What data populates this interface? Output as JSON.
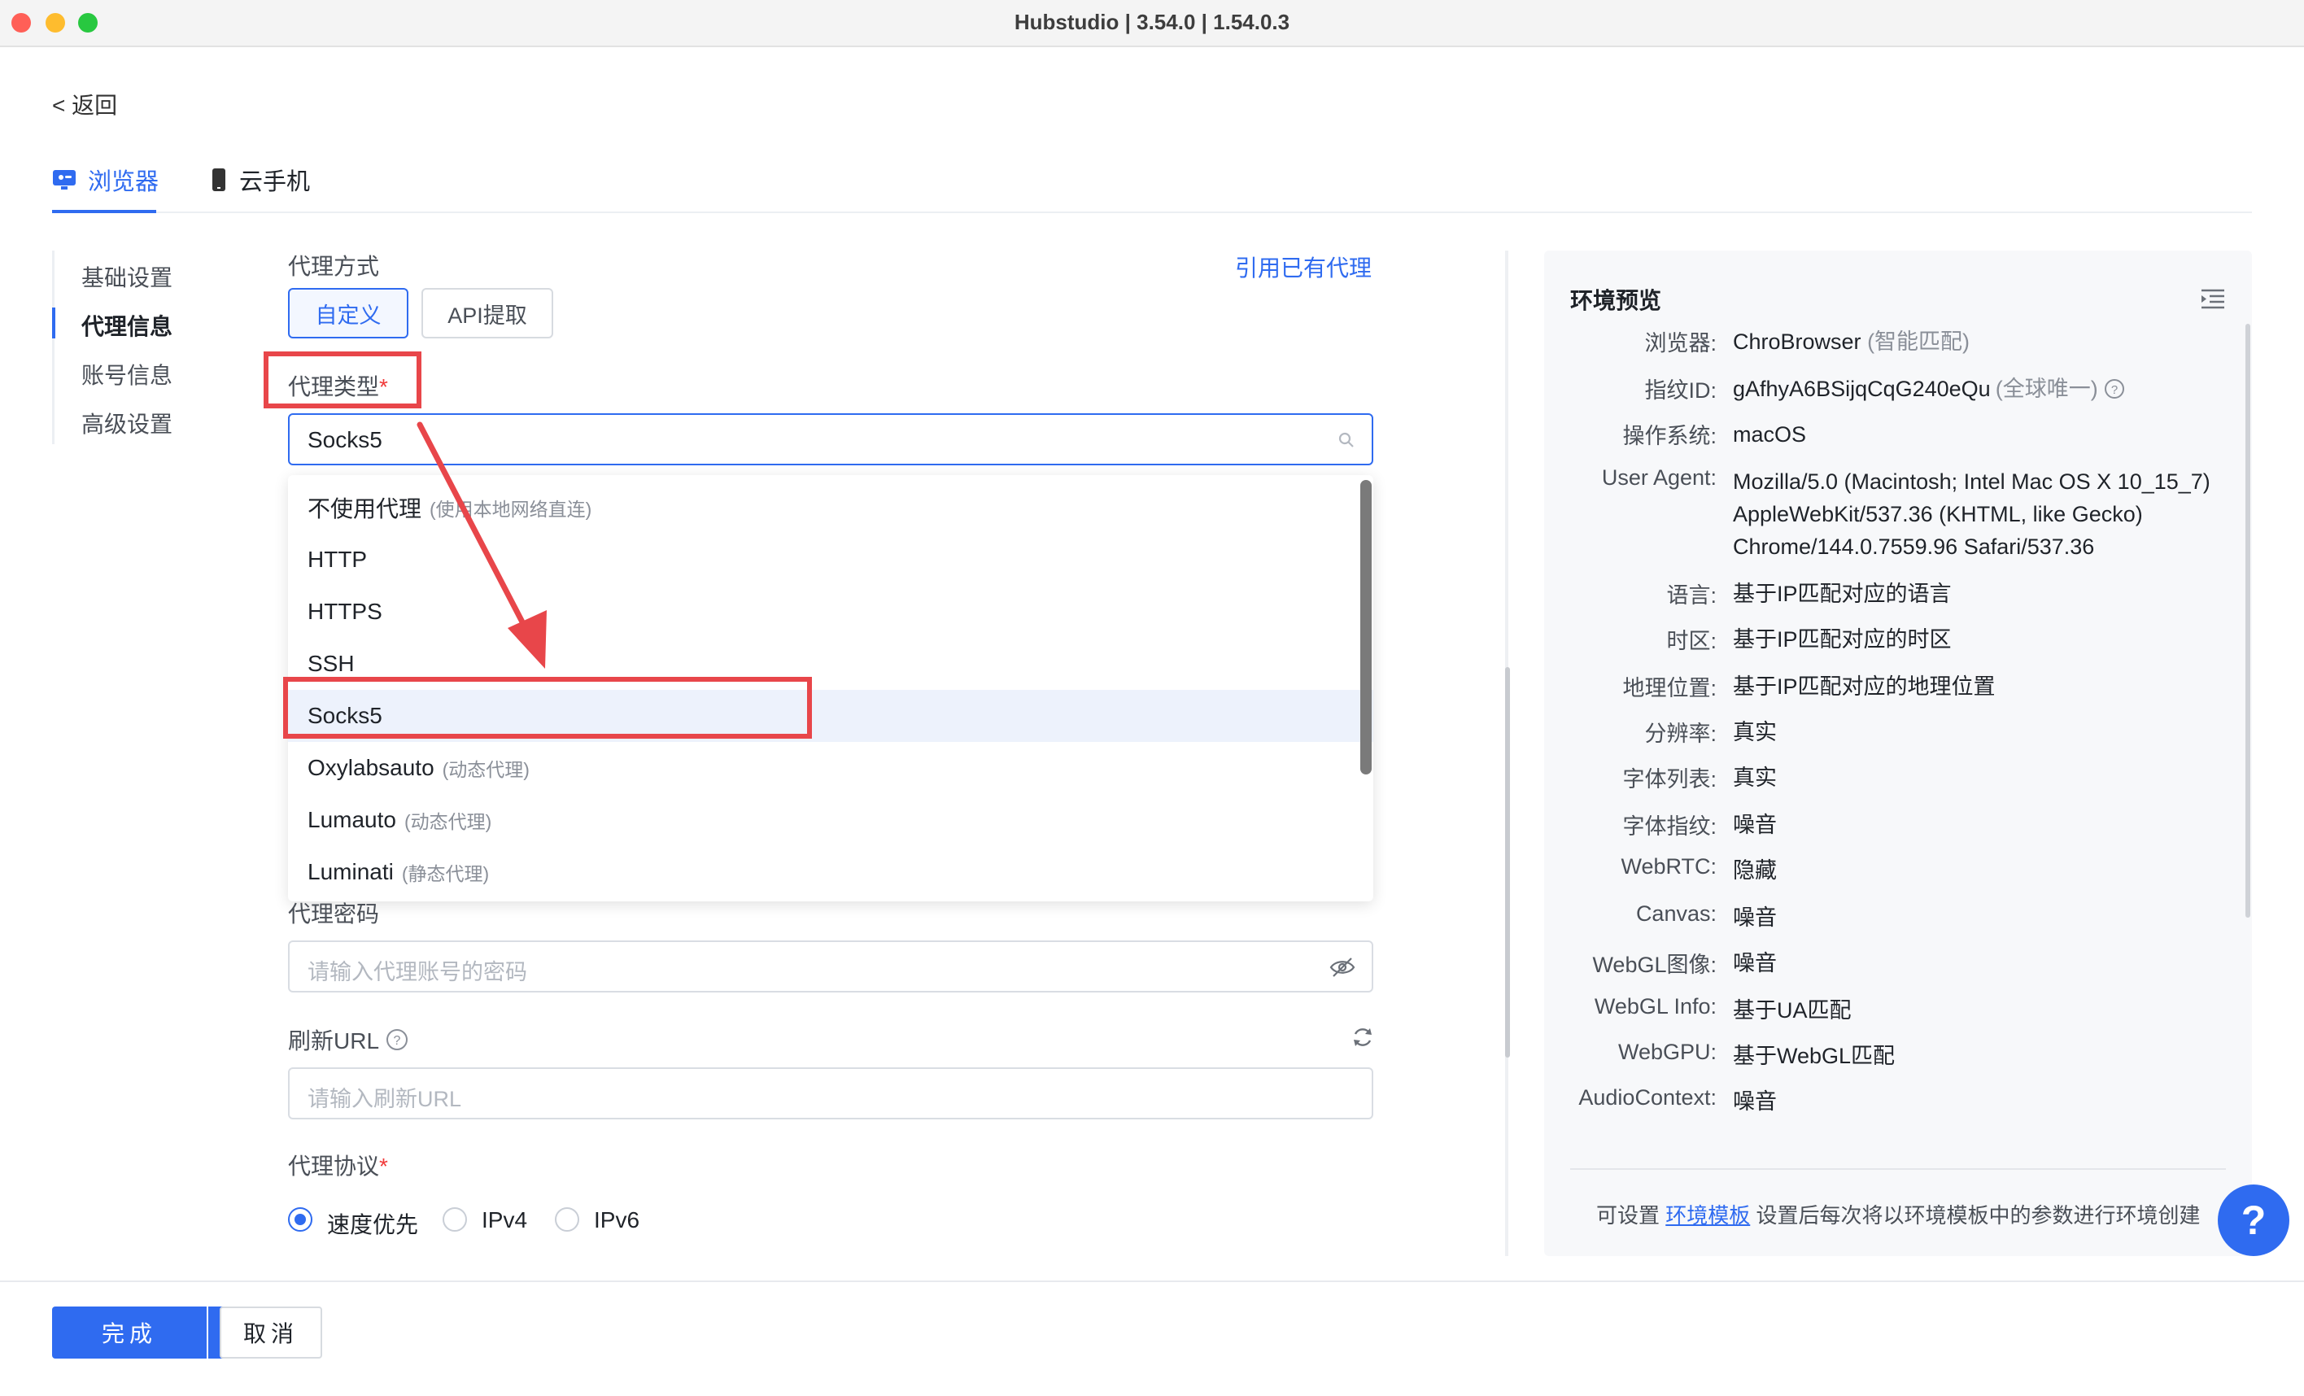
{
  "window": {
    "title": "Hubstudio | 3.54.0 | 1.54.0.3"
  },
  "back_link": "< 返回",
  "tabs": [
    {
      "label": "浏览器",
      "icon": "monitor-icon",
      "active": true
    },
    {
      "label": "云手机",
      "icon": "phone-icon",
      "active": false
    }
  ],
  "sidebar": {
    "items": [
      {
        "label": "基础设置",
        "active": false
      },
      {
        "label": "代理信息",
        "active": true
      },
      {
        "label": "账号信息",
        "active": false
      },
      {
        "label": "高级设置",
        "active": false
      }
    ]
  },
  "proxy": {
    "method_label": "代理方式",
    "use_existing_link": "引用已有代理",
    "method_options": [
      "自定义",
      "API提取"
    ],
    "type_label": "代理类型",
    "type_required": "*",
    "type_value": "Socks5",
    "type_options": [
      {
        "label": "不使用代理",
        "hint": "(使用本地网络直连)"
      },
      {
        "label": "HTTP",
        "hint": ""
      },
      {
        "label": "HTTPS",
        "hint": ""
      },
      {
        "label": "SSH",
        "hint": ""
      },
      {
        "label": "Socks5",
        "hint": "",
        "selected": true
      },
      {
        "label": "Oxylabsauto",
        "hint": "(动态代理)"
      },
      {
        "label": "Lumauto",
        "hint": "(动态代理)"
      },
      {
        "label": "Luminati",
        "hint": "(静态代理)"
      }
    ],
    "password_label": "代理密码",
    "password_placeholder": "请输入代理账号的密码",
    "refresh_url_label": "刷新URL",
    "refresh_url_placeholder": "请输入刷新URL",
    "protocol_label": "代理协议",
    "protocol_required": "*",
    "protocol_options": [
      {
        "label": "速度优先",
        "checked": true
      },
      {
        "label": "IPv4",
        "checked": false
      },
      {
        "label": "IPv6",
        "checked": false
      }
    ]
  },
  "preview": {
    "title": "环境预览",
    "rows": [
      {
        "key": "浏览器:",
        "value": "ChroBrowser",
        "extra": "(智能匹配)"
      },
      {
        "key": "指纹ID:",
        "value": "gAfhyA6BSijqCqG240eQu",
        "extra": "(全球唯一)"
      },
      {
        "key": "操作系统:",
        "value": "macOS",
        "extra": ""
      },
      {
        "key": "User Agent:",
        "value": "Mozilla/5.0 (Macintosh; Intel Mac OS X 10_15_7) AppleWebKit/537.36 (KHTML, like Gecko) Chrome/144.0.7559.96 Safari/537.36",
        "extra": ""
      },
      {
        "key": "语言:",
        "value": "基于IP匹配对应的语言",
        "extra": ""
      },
      {
        "key": "时区:",
        "value": "基于IP匹配对应的时区",
        "extra": ""
      },
      {
        "key": "地理位置:",
        "value": "基于IP匹配对应的地理位置",
        "extra": ""
      },
      {
        "key": "分辨率:",
        "value": "真实",
        "extra": ""
      },
      {
        "key": "字体列表:",
        "value": "真实",
        "extra": ""
      },
      {
        "key": "字体指纹:",
        "value": "噪音",
        "extra": ""
      },
      {
        "key": "WebRTC:",
        "value": "隐藏",
        "extra": ""
      },
      {
        "key": "Canvas:",
        "value": "噪音",
        "extra": ""
      },
      {
        "key": "WebGL图像:",
        "value": "噪音",
        "extra": ""
      },
      {
        "key": "WebGL Info:",
        "value": "基于UA匹配",
        "extra": ""
      },
      {
        "key": "WebGPU:",
        "value": "基于WebGL匹配",
        "extra": ""
      },
      {
        "key": "AudioContext:",
        "value": "噪音",
        "extra": ""
      }
    ],
    "footer_prefix": "可设置",
    "footer_link": "环境模板",
    "footer_suffix": "设置后每次将以环境模板中的参数进行环境创建"
  },
  "help_button": "?",
  "footer": {
    "done_label": "完成",
    "cancel_label": "取消"
  },
  "annotation_color": "#e8464a"
}
